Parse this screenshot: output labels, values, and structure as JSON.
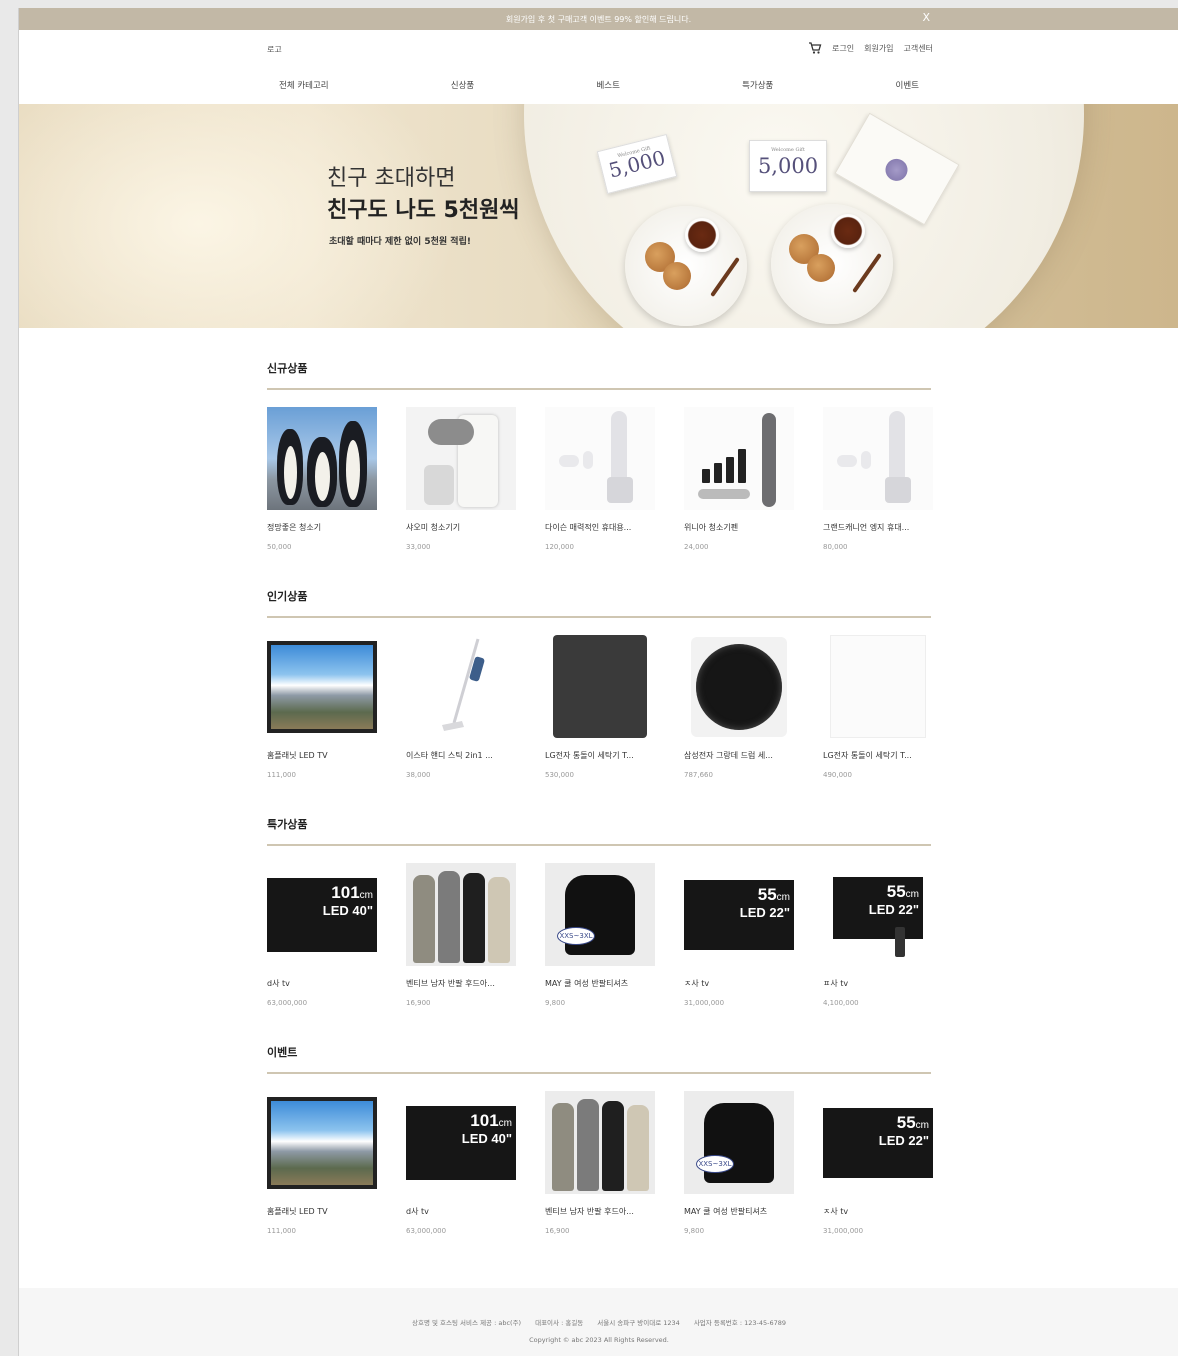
{
  "topbar": {
    "message": "회원가입 후 첫 구매고객 이벤트 99% 할인해 드립니다.",
    "close": "X"
  },
  "header": {
    "logo": "로고",
    "login": "로그인",
    "signup": "회원가입",
    "support": "고객센터"
  },
  "nav": [
    "전체 카테고리",
    "신상품",
    "베스트",
    "특가상품",
    "이벤트"
  ],
  "hero": {
    "line1": "친구 초대하면",
    "line2": "친구도 나도 5천원씩",
    "sub": "초대할 때마다 제한 없이 5천원 적립!",
    "card_label": "Welcome Gift",
    "card_value": "5,000"
  },
  "sections": [
    {
      "title": "신규상품",
      "items": [
        {
          "name": "정망좋은 청소기",
          "price": "50,000"
        },
        {
          "name": "샤오미 청소기기",
          "price": "33,000"
        },
        {
          "name": "다이슨 매력적인 휴대용...",
          "price": "120,000"
        },
        {
          "name": "위니아 청소기펜",
          "price": "24,000"
        },
        {
          "name": "그랜드캐니언 엥지 휴대...",
          "price": "80,000"
        }
      ]
    },
    {
      "title": "인기상품",
      "items": [
        {
          "name": "홈플래닛 LED TV",
          "price": "111,000"
        },
        {
          "name": "이스타 핸디 스틱 2in1 ...",
          "price": "38,000"
        },
        {
          "name": "LG전자 통돌이 세탁기 T...",
          "price": "530,000"
        },
        {
          "name": "삼성전자 그랑데 드럼 세...",
          "price": "787,660"
        },
        {
          "name": "LG전자 통돌이 세탁기 T...",
          "price": "490,000"
        }
      ]
    },
    {
      "title": "특가상품",
      "items": [
        {
          "name": "d사 tv",
          "price": "63,000,000"
        },
        {
          "name": "벤티브 남자 반팔 후드아...",
          "price": "16,900"
        },
        {
          "name": "MAY 쿨 여성 반팔티셔츠",
          "price": "9,800"
        },
        {
          "name": "ㅈ사 tv",
          "price": "31,000,000"
        },
        {
          "name": "ㅍ사 tv",
          "price": "4,100,000"
        }
      ]
    },
    {
      "title": "이벤트",
      "items": [
        {
          "name": "홈플래닛 LED TV",
          "price": "111,000"
        },
        {
          "name": "d사 tv",
          "price": "63,000,000"
        },
        {
          "name": "벤티브 남자 반팔 후드아...",
          "price": "16,900"
        },
        {
          "name": "MAY 쿨 여성 반팔티셔츠",
          "price": "9,800"
        },
        {
          "name": "ㅈ사 tv",
          "price": "31,000,000"
        }
      ]
    }
  ],
  "tv_labels": {
    "size101": "101",
    "unit_cm": "cm",
    "led40": "LED 40\"",
    "size55": "55",
    "led22": "LED 22\"",
    "size_tag": "XXS~3XL"
  },
  "footer": {
    "company": "상호명 및 호스팅 서비스 제공 : abc(주)",
    "ceo": "대표이사 : 홍길동",
    "address": "서울시 송파구 방이대로 1234",
    "biz_no": "사업자 등록번호 : 123-45-6789",
    "copyright": "Copyright © abc 2023 All Rights Reserved."
  },
  "colors": {
    "accent": "#c2b8a6",
    "divider": "#cfc6b2"
  },
  "icons": {
    "cart": "cart-icon",
    "close": "close-icon"
  }
}
